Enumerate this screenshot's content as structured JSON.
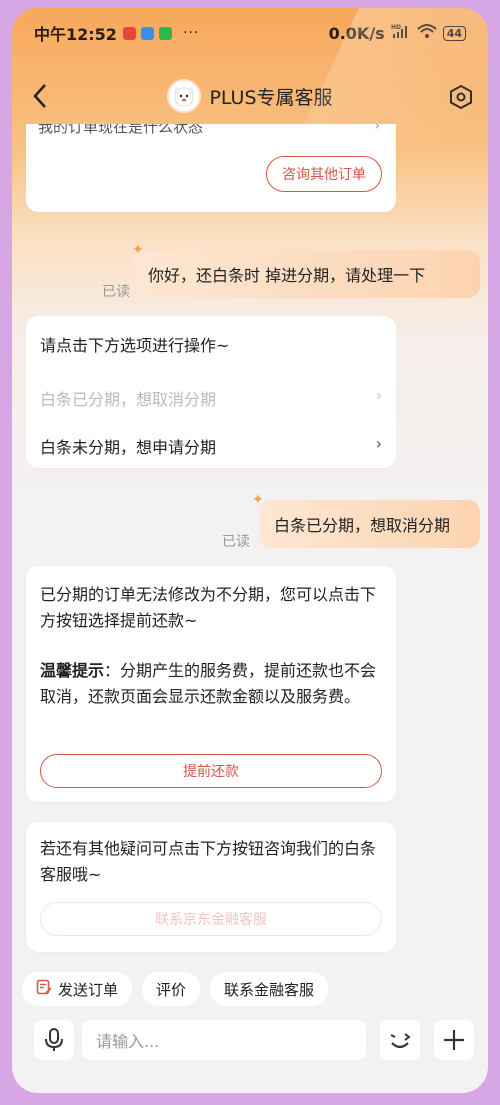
{
  "status_bar": {
    "time": "中午12:52",
    "more": "···",
    "speed": "0.0K/s",
    "network": "HD",
    "battery": "44"
  },
  "header": {
    "title": "PLUS专属客服"
  },
  "chat": {
    "prev_card": {
      "text": "我的订单现在是什么状态",
      "button": "咨询其他订单"
    },
    "msg_user_1": "你好，还白条时 掉进分期，请处理一下",
    "read_label_1": "已读",
    "options_card": {
      "title": "请点击下方选项进行操作~",
      "option_1": "白条已分期，想取消分期",
      "option_2": "白条未分期，想申请分期"
    },
    "msg_user_2": "白条已分期，想取消分期",
    "read_label_2": "已读",
    "answer_card": {
      "para_1": "已分期的订单无法修改为不分期，您可以点击下方按钮选择提前还款~",
      "tip_label": "温馨提示",
      "tip_text": "：分期产生的服务费，提前还款也不会取消，还款页面会显示还款金额以及服务费。",
      "button": "提前还款"
    },
    "contact_card": {
      "text": "若还有其他疑问可点击下方按钮咨询我们的白条客服哦~",
      "button": "联系京东金融客服"
    }
  },
  "quick_actions": {
    "send_order": "发送订单",
    "rate": "评价",
    "finance_service": "联系金融客服"
  },
  "input": {
    "placeholder": "请输入..."
  },
  "colors": {
    "accent": "#d5574a",
    "header_gradient_top": "#f7a85a",
    "user_bubble": "#fcd3b1",
    "frame": "#d7a6e4"
  }
}
